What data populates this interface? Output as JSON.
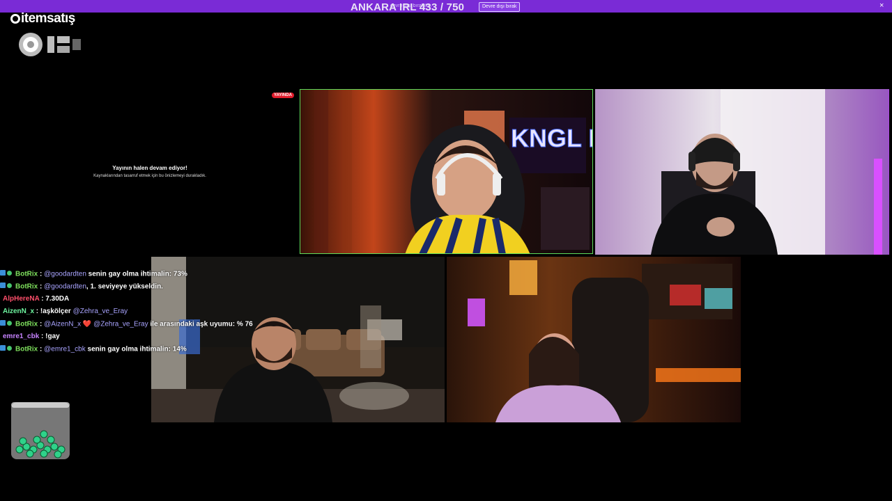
{
  "topbar": {
    "goal_text": "ANKARA IRL 433 / 750",
    "notice_text": "devre dışı bırakıldı.",
    "drop_button": "Devre dışı bırak",
    "close": "×"
  },
  "brand": {
    "logo_text": "itemsatış"
  },
  "stream": {
    "live_tag": "YAYINDA",
    "paused_title": "Yayının halen devam ediyor!",
    "paused_subtitle": "Kaynaklarından tasarruf etmek için bu önizlemeyi durakladık."
  },
  "cams": {
    "cam1_sign": "KNGL MUSIC"
  },
  "chat": [
    {
      "badges": true,
      "user": "BotRix",
      "user_color": "#7ee05d",
      "sep": " : ",
      "mention": "@goodardten",
      "text": " senin gay olma ihtimalin: 73%"
    },
    {
      "badges": true,
      "user": "BotRix",
      "user_color": "#7ee05d",
      "sep": " : ",
      "mention": "@goodardten",
      "text": ", 1. seviyeye yükseldin."
    },
    {
      "badges": false,
      "user": "AlpHereNA",
      "user_color": "#ff4f6b",
      "sep": " : ",
      "mention": "",
      "text": "7.30DA"
    },
    {
      "badges": false,
      "user": "AizenN_x",
      "user_color": "#6ef6a0",
      "sep": " : ",
      "mention": "@Zehra_ve_Eray",
      "text": "",
      "prefix": "!aşkölçer "
    },
    {
      "badges": true,
      "user": "BotRix",
      "user_color": "#7ee05d",
      "sep": " : ",
      "mention": "@AizenN_x",
      "text": " ile arasındaki aşk uyumu: % 76",
      "heart": "❤️",
      "mention2": "@Zehra_ve_Eray"
    },
    {
      "badges": false,
      "user": "emre1_cbk",
      "user_color": "#c783ff",
      "sep": " : ",
      "mention": "",
      "text": "!gay"
    },
    {
      "badges": true,
      "user": "BotRix",
      "user_color": "#7ee05d",
      "sep": " : ",
      "mention": "@emre1_cbk",
      "text": " senin gay olma ihtimalin: 14%"
    }
  ]
}
